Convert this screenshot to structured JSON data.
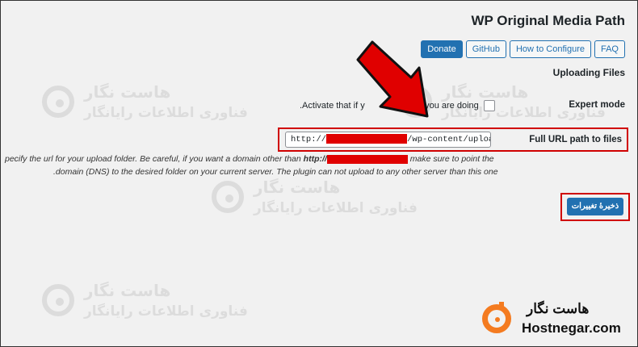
{
  "header": {
    "title": "WP Original Media Path",
    "buttons": [
      "Donate",
      "GitHub",
      "How to Configure",
      "FAQ"
    ]
  },
  "section_heading": "Uploading Files",
  "expert_mode": {
    "label": "Expert mode",
    "desc_start": ".Activate that if y",
    "desc_end": "f what you are doing",
    "checked": false
  },
  "url_field": {
    "label": "Full URL path to files",
    "prefix": "http://",
    "suffix": "/wp-content/uploads"
  },
  "help": {
    "line1_a": "pecify the url for your upload folder. Be careful, if you want a domain other than ",
    "line1_b": "http://",
    "line1_c": " make sure to point the",
    "line2": ".domain (DNS) to the desired folder on your current server. The plugin can not upload to any other server than this one"
  },
  "save_button": "ذخیرهٔ تغییرات",
  "watermark": {
    "line1": "هاست نگار",
    "line2": "فناوری اطلاعات رایانگار"
  },
  "brand": {
    "fa": "هاست نگار",
    "en": "Hostnegar.com"
  },
  "colors": {
    "accent": "#2271b1",
    "highlight": "#d00000",
    "brand": "#f47b20"
  }
}
